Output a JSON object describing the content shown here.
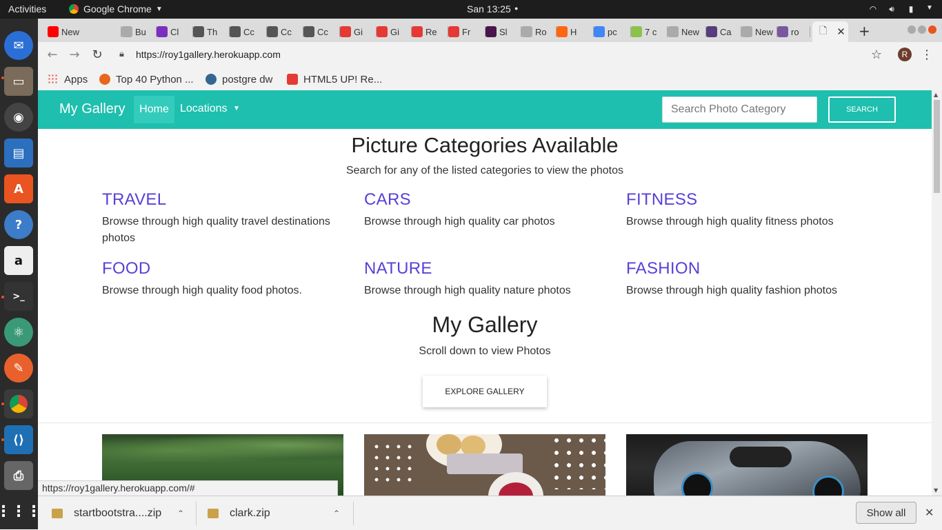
{
  "os": {
    "activities": "Activities",
    "app_name": "Google Chrome",
    "clock": "San 13:25"
  },
  "tabs": [
    {
      "label": "New",
      "icon": "youtube-icon",
      "color": "#ff0000"
    },
    {
      "label": "Bu",
      "icon": "page-icon",
      "color": "#aaaaaa"
    },
    {
      "label": "Cl",
      "icon": "colorlib-icon",
      "color": "#7b2fbe"
    },
    {
      "label": "Th",
      "icon": "wordpress-icon",
      "color": "#555555"
    },
    {
      "label": "Cc",
      "icon": "wordpress-icon",
      "color": "#555555"
    },
    {
      "label": "Cc",
      "icon": "wordpress-icon",
      "color": "#555555"
    },
    {
      "label": "Cc",
      "icon": "wordpress-icon",
      "color": "#555555"
    },
    {
      "label": "Gi",
      "icon": "s-icon",
      "color": "#e53935"
    },
    {
      "label": "Gi",
      "icon": "s-icon",
      "color": "#e53935"
    },
    {
      "label": "Re",
      "icon": "s-icon",
      "color": "#e53935"
    },
    {
      "label": "Fr",
      "icon": "s-icon",
      "color": "#e53935"
    },
    {
      "label": "Sl",
      "icon": "slack-icon",
      "color": "#4a154b"
    },
    {
      "label": "Ro",
      "icon": "page-icon",
      "color": "#aaaaaa"
    },
    {
      "label": "H",
      "icon": "firefox-icon",
      "color": "#ff6611"
    },
    {
      "label": "pc",
      "icon": "google-icon",
      "color": "#4285f4"
    },
    {
      "label": "7 c",
      "icon": "gear-icon",
      "color": "#8bc34a"
    },
    {
      "label": "New",
      "icon": "page-icon",
      "color": "#aaaaaa"
    },
    {
      "label": "Ca",
      "icon": "bootstrap-icon",
      "color": "#563d7c"
    },
    {
      "label": "New",
      "icon": "page-icon",
      "color": "#aaaaaa"
    },
    {
      "label": "ro",
      "icon": "heroku-icon",
      "color": "#79589f"
    }
  ],
  "url": "https://roy1gallery.herokuapp.com",
  "profile_initial": "R",
  "bookmarks": [
    {
      "label": "Apps",
      "icon": "apps-grid-icon"
    },
    {
      "label": "Top 40 Python ...",
      "icon": "python-list-icon"
    },
    {
      "label": "postgre dw",
      "icon": "postgres-icon"
    },
    {
      "label": "HTML5 UP! Re...",
      "icon": "html5up-icon"
    }
  ],
  "navbar": {
    "brand": "My Gallery",
    "home": "Home",
    "locations": "Locations",
    "search_placeholder": "Search Photo Category",
    "search_button": "Search",
    "color": "#1ebfae"
  },
  "main": {
    "heading": "Picture Categories Available",
    "subheading": "Search for any of the listed categories to view the photos",
    "categories": [
      {
        "title": "TRAVEL",
        "desc": "Browse through high quality travel destinations photos"
      },
      {
        "title": "CARS",
        "desc": "Browse through high quality car photos"
      },
      {
        "title": "FITNESS",
        "desc": "Browse through high quality fitness photos"
      },
      {
        "title": "FOOD",
        "desc": "Browse through high quality food photos."
      },
      {
        "title": "NATURE",
        "desc": "Browse through high quality nature photos"
      },
      {
        "title": "FASHION",
        "desc": "Browse through high quality fashion photos"
      }
    ],
    "gallery_heading": "My Gallery",
    "gallery_sub": "Scroll down to view Photos",
    "explore_button": "Explore Gallery"
  },
  "status_url": "https://roy1gallery.herokuapp.com/#",
  "downloads": [
    {
      "name": "startbootstra....zip"
    },
    {
      "name": "clark.zip"
    }
  ],
  "show_all": "Show all"
}
